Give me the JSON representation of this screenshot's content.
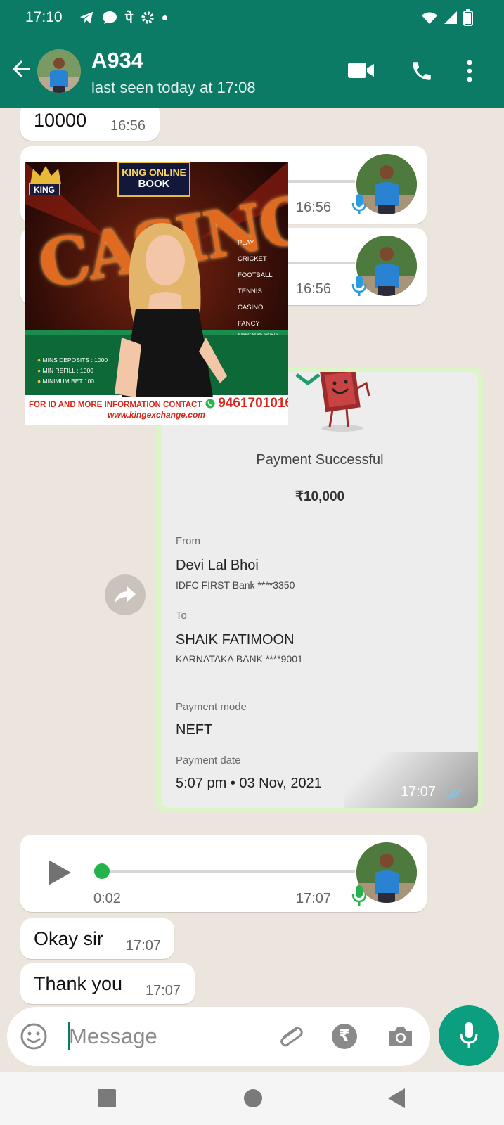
{
  "status_bar": {
    "time": "17:10",
    "app_letter": "पे"
  },
  "header": {
    "contact_name": "A934",
    "last_seen": "last seen today at 17:08"
  },
  "messages": {
    "m1": {
      "text": "10000",
      "time": "16:56"
    },
    "voice1": {
      "time": "16:56"
    },
    "voice2": {
      "time": "16:56"
    },
    "ad": {
      "brand_line1": "KING ONLINE",
      "brand_line2": "BOOK",
      "crown": "KING",
      "casino": "CASINO",
      "menu": [
        "PLAY",
        "CRICKET",
        "FOOTBALL",
        "TENNIS",
        "CASINO",
        "FANCY",
        "& MANY MORE SPORTS"
      ],
      "perks": [
        "MINS DEPOSITS : 1000",
        "MIN REFILL : 1000",
        "MINIMUM BET 100"
      ],
      "contact_line": "FOR ID AND MORE INFORMATION CONTACT",
      "phone": "9461701016",
      "site": "www.kingexchange.com"
    },
    "payment": {
      "status": "Payment Successful",
      "amount": "₹10,000",
      "from_label": "From",
      "from_name": "Devi Lal Bhoi",
      "from_bank": "IDFC FIRST Bank ****3350",
      "to_label": "To",
      "to_name": "SHAIK FATIMOON",
      "to_bank": "KARNATAKA BANK ****9001",
      "mode_label": "Payment mode",
      "mode": "NEFT",
      "date_label": "Payment date",
      "date": "5:07 pm • 03 Nov, 2021",
      "time": "17:07"
    },
    "voice3": {
      "duration": "0:02",
      "time": "17:07",
      "progress": 0.0
    },
    "m2": {
      "text": "Okay sir",
      "time": "17:07"
    },
    "m3": {
      "text": "Thank you",
      "time": "17:07"
    }
  },
  "composer": {
    "placeholder": "Message"
  },
  "colors": {
    "header": "#0b7b66",
    "chat_bg": "#ece5dd",
    "accent": "#0c9f7f",
    "mic_blue": "#2b9be0",
    "mic_green": "#23b34a"
  }
}
